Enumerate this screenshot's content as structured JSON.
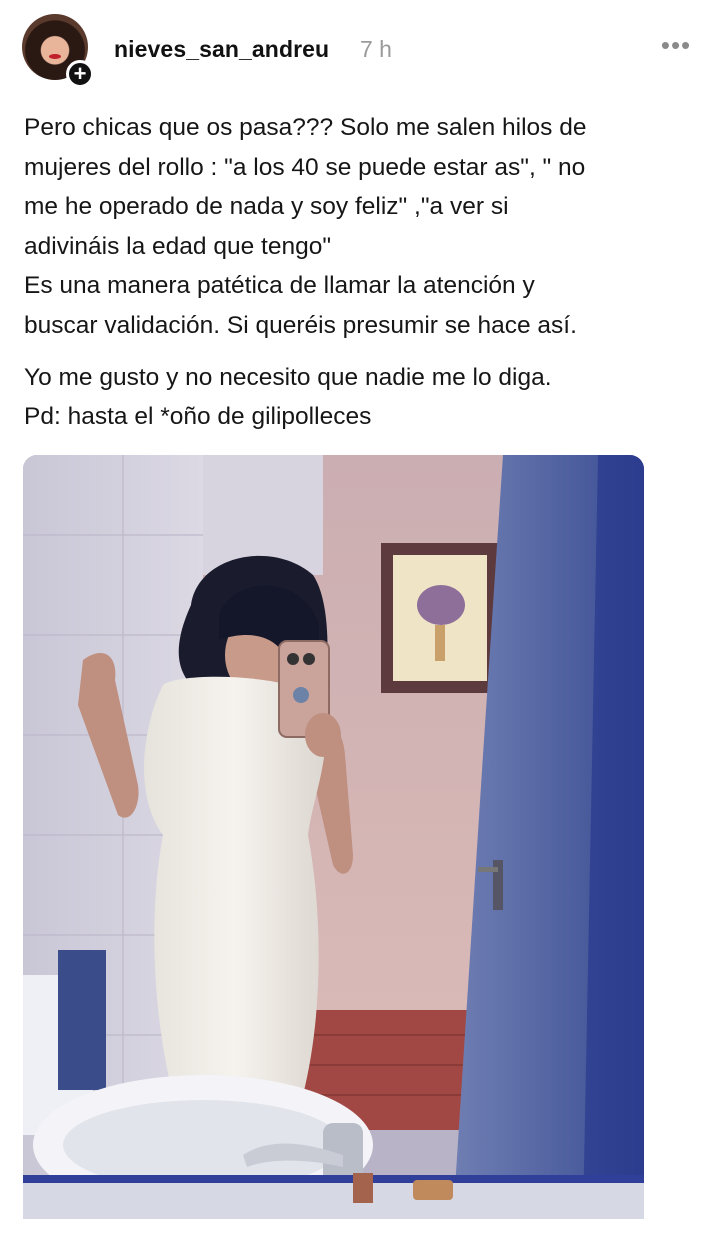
{
  "post": {
    "author": {
      "username": "nieves_san_andreu",
      "avatar_icon": "profile-avatar",
      "follow_icon": "plus-icon",
      "follow_label": "+"
    },
    "timestamp": "7 h",
    "more_label": "•••",
    "caption": {
      "lines": [
        "Pero chicas que os pasa??? Solo me salen hilos de",
        "mujeres del rollo : \"a los 40 se puede estar as\", \" no",
        "me he operado de nada y soy feliz\" ,\"a ver si",
        "adivináis la edad que tengo\"",
        "Es una manera patética de llamar la atención y",
        "buscar validación. Si queréis presumir se hace así.",
        "Yo me gusto y no necesito que nadie me lo diga.",
        "Pd: hasta el *oño de gilipolleces"
      ]
    },
    "image": {
      "description_icon": "mirror-selfie-photo"
    }
  }
}
